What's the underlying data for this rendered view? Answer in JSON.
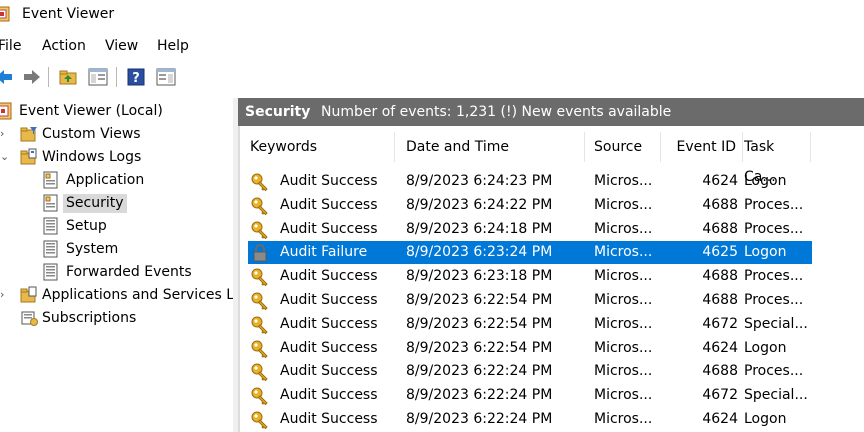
{
  "window": {
    "title": "Event Viewer"
  },
  "menu": [
    "File",
    "Action",
    "View",
    "Help"
  ],
  "toolbar": [
    "back-icon",
    "forward-icon",
    "folder-up-icon",
    "show-hide-tree-icon",
    "help-icon",
    "show-action-pane-icon"
  ],
  "tree": {
    "root": "Event Viewer (Local)",
    "custom_views": "Custom Views",
    "windows_logs": "Windows Logs",
    "logs": [
      "Application",
      "Security",
      "Setup",
      "System",
      "Forwarded Events"
    ],
    "apps_services": "Applications and Services Lo",
    "subscriptions": "Subscriptions"
  },
  "pane_header": {
    "name": "Security",
    "info": "Number of events: 1,231 (!) New events available"
  },
  "table": {
    "columns": [
      "Keywords",
      "Date and Time",
      "Source",
      "Event ID",
      "Task Ca..."
    ],
    "rows": [
      [
        "Audit Success",
        "8/9/2023 6:24:23 PM",
        "Micros...",
        "4624",
        "Logon"
      ],
      [
        "Audit Success",
        "8/9/2023 6:24:22 PM",
        "Micros...",
        "4688",
        "Proces..."
      ],
      [
        "Audit Success",
        "8/9/2023 6:24:18 PM",
        "Micros...",
        "4688",
        "Proces..."
      ],
      [
        "Audit Failure",
        "8/9/2023 6:23:24 PM",
        "Micros...",
        "4625",
        "Logon"
      ],
      [
        "Audit Success",
        "8/9/2023 6:23:18 PM",
        "Micros...",
        "4688",
        "Proces..."
      ],
      [
        "Audit Success",
        "8/9/2023 6:22:54 PM",
        "Micros...",
        "4688",
        "Proces..."
      ],
      [
        "Audit Success",
        "8/9/2023 6:22:54 PM",
        "Micros...",
        "4672",
        "Special..."
      ],
      [
        "Audit Success",
        "8/9/2023 6:22:54 PM",
        "Micros...",
        "4624",
        "Logon"
      ],
      [
        "Audit Success",
        "8/9/2023 6:22:24 PM",
        "Micros...",
        "4688",
        "Proces..."
      ],
      [
        "Audit Success",
        "8/9/2023 6:22:24 PM",
        "Micros...",
        "4672",
        "Special..."
      ],
      [
        "Audit Success",
        "8/9/2023 6:22:24 PM",
        "Micros...",
        "4624",
        "Logon"
      ]
    ]
  },
  "colors": {
    "selection": "#0078d7",
    "header": "#6b6b6b",
    "key": "#d9a21b"
  }
}
